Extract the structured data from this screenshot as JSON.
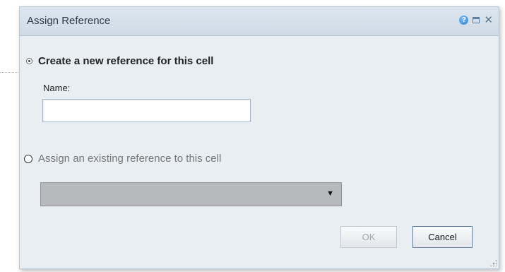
{
  "dialog": {
    "title": "Assign Reference",
    "controls": {
      "help_glyph": "?",
      "close_glyph": "✕"
    }
  },
  "option_new": {
    "label": "Create a new reference for this cell",
    "selected": true
  },
  "name_field": {
    "label": "Name:",
    "value": "",
    "placeholder": ""
  },
  "option_existing": {
    "label": "Assign an existing reference to this cell",
    "selected": false
  },
  "reference_dropdown": {
    "value": "",
    "arrow_glyph": "▼",
    "disabled": true
  },
  "buttons": {
    "ok": "OK",
    "cancel": "Cancel"
  },
  "colors": {
    "dialog_bg": "#e9eef3",
    "titlebar": "#d6e0ea",
    "dropdown_disabled": "#b7b9bd"
  }
}
